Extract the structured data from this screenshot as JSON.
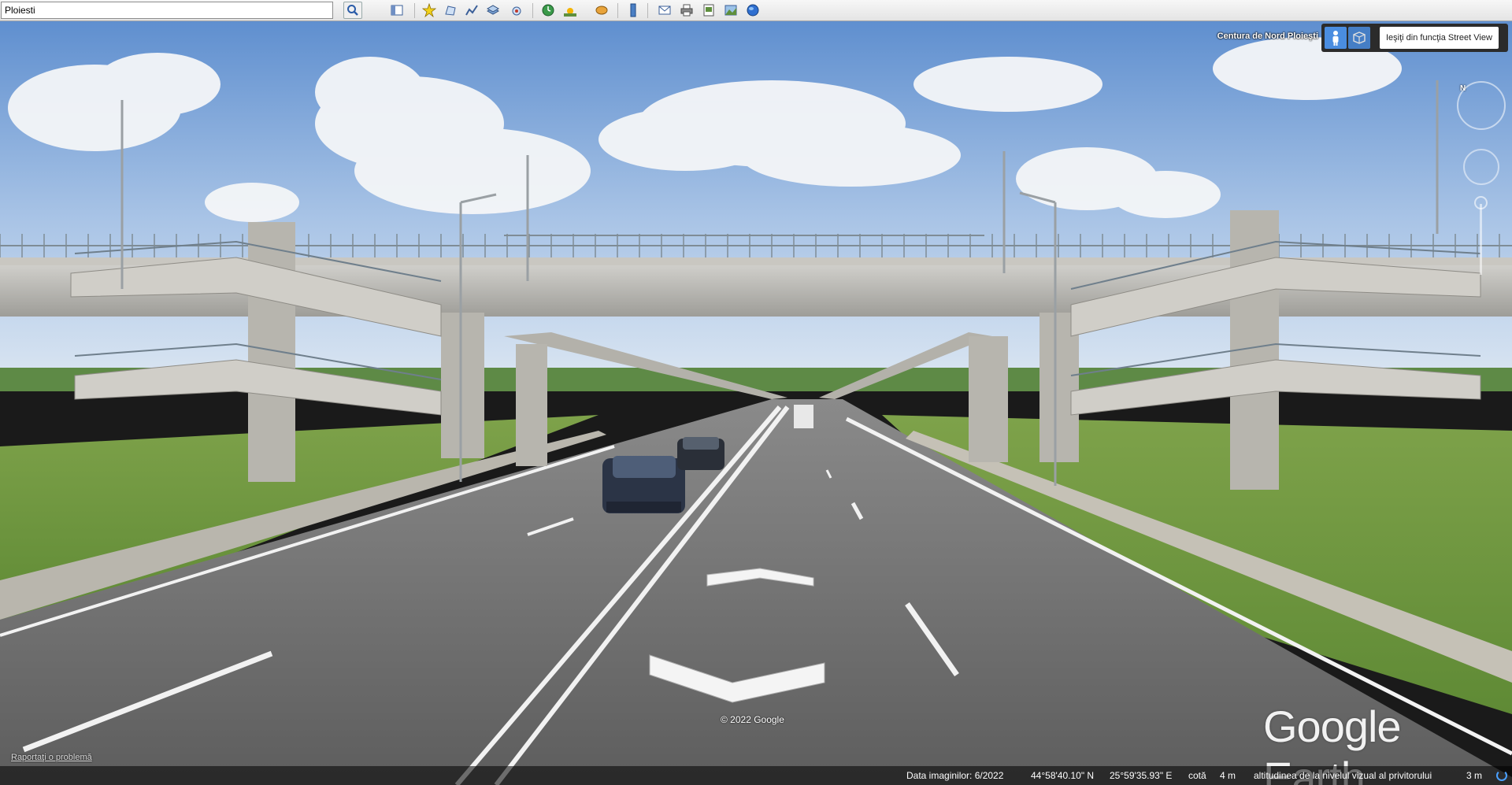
{
  "toolbar": {
    "search_value": "Ploiesti",
    "buttons": [
      "search-icon",
      "sidebar-icon",
      "placemark-icon",
      "polygon-icon",
      "path-icon",
      "overlay-icon",
      "tour-icon",
      "history-icon",
      "sunlight-icon",
      "planets-icon",
      "ruler-icon",
      "email-icon",
      "print-icon",
      "save-image-icon",
      "map-image-icon",
      "maps-icon"
    ]
  },
  "streetview": {
    "road_label": "Centura de Nord Ploieşti",
    "exit_label": "Ieşiţi din funcţia Street View"
  },
  "navigation": {
    "north_label": "N"
  },
  "overlay": {
    "copyright": "© 2022 Google",
    "report_problem": "Raportaţi o problemă",
    "logo": "Google Earth"
  },
  "status": {
    "imagery_date": "Data imaginilor: 6/2022",
    "latitude": "44°58'40.10\" N",
    "longitude": "25°59'35.93\" E",
    "elevation_label": "cotă",
    "elevation_value": "4 m",
    "eye_alt_label": "altitudinea de la nivelul vizual al privitorului",
    "eye_alt_value": "3 m"
  },
  "colors": {
    "accent": "#4a8de0",
    "sky": "#7aa3d6",
    "road": "#6e6e6e",
    "grass": "#6f9a3e"
  }
}
